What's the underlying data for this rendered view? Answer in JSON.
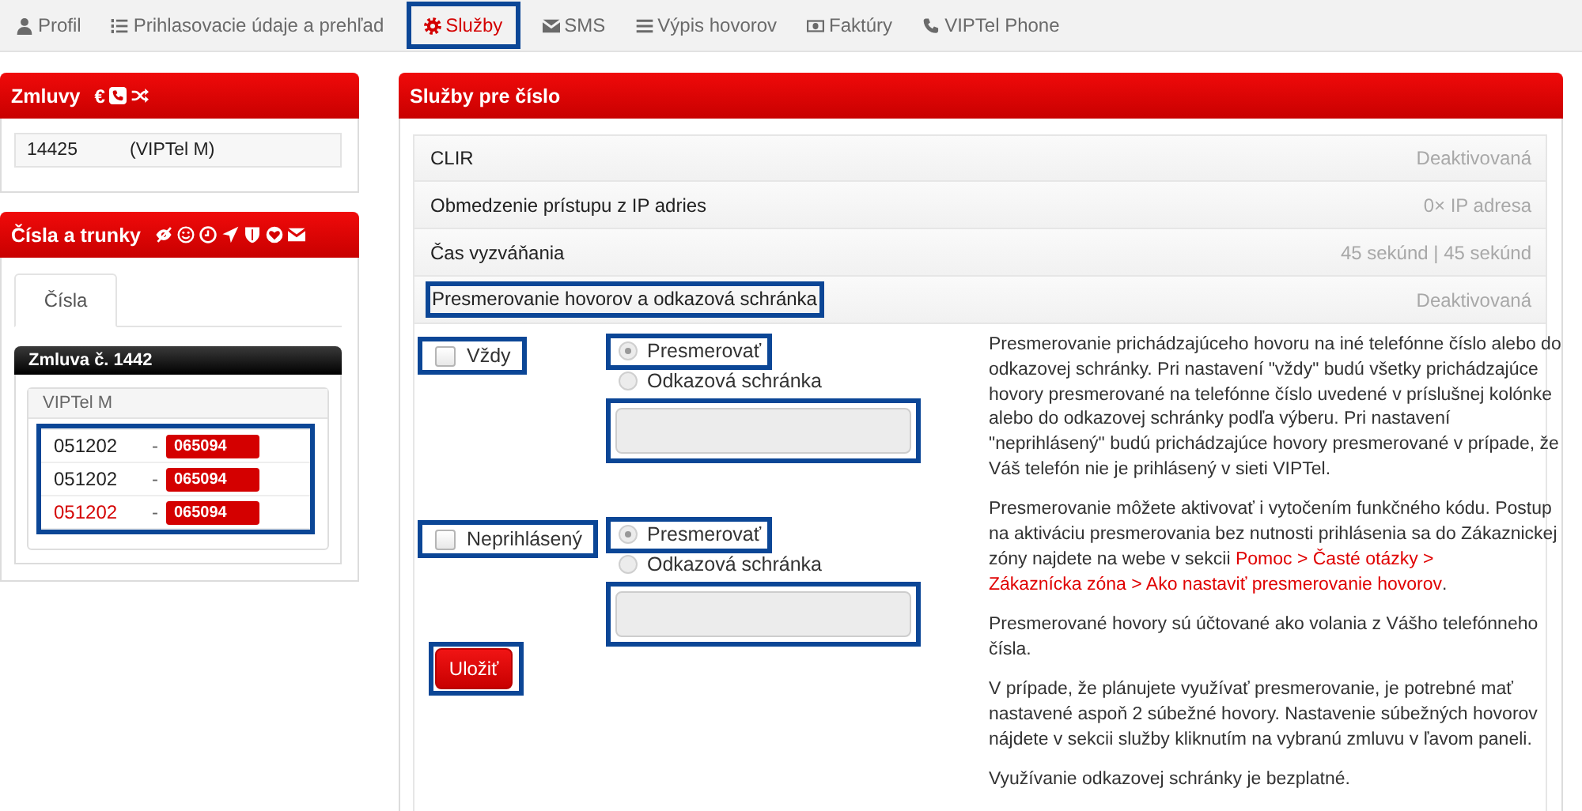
{
  "nav": [
    {
      "label": "Profil",
      "selected": false,
      "highlighted": false
    },
    {
      "label": "Prihlasovacie údaje a prehľad",
      "selected": false,
      "highlighted": false
    },
    {
      "label": "Služby",
      "selected": true,
      "highlighted": true
    },
    {
      "label": "SMS",
      "selected": false,
      "highlighted": false
    },
    {
      "label": "Výpis hovorov",
      "selected": false,
      "highlighted": false
    },
    {
      "label": "Faktúry",
      "selected": false,
      "highlighted": false
    },
    {
      "label": "VIPTel Phone",
      "selected": false,
      "highlighted": false
    }
  ],
  "sidebar": {
    "contracts": {
      "title": "Zmluvy",
      "symbol": "€",
      "rows": [
        {
          "number": "14425",
          "plan": "(VIPTel M)"
        }
      ]
    },
    "numbers": {
      "title": "Čísla a trunky",
      "tabs": [
        {
          "label": "Čísla",
          "selected": true
        }
      ],
      "contract": {
        "title": "Zmluva č. 1442",
        "plan": "VIPTel M",
        "highlighted": true,
        "lines": [
          {
            "number": "051202",
            "separator": "-",
            "badge": "065094",
            "selected": false
          },
          {
            "number": "051202",
            "separator": "-",
            "badge": "065094",
            "selected": false
          },
          {
            "number": "051202",
            "separator": "-",
            "badge": "065094",
            "selected": true
          }
        ]
      }
    }
  },
  "main": {
    "title": "Služby pre číslo",
    "services": [
      {
        "name": "CLIR",
        "status": "Deaktivovaná",
        "highlighted": false
      },
      {
        "name": "Obmedzenie prístupu z IP adries",
        "status": "0× IP adresa",
        "highlighted": false
      },
      {
        "name": "Čas vyzváňania",
        "status": "45 sekúnd | 45 sekúnd",
        "highlighted": false
      },
      {
        "name": "Presmerovanie hovorov a odkazová schránka",
        "status": "Deaktivovaná",
        "highlighted": true
      }
    ],
    "forwarding": {
      "options": [
        {
          "label": "Vždy",
          "checked": false,
          "highlighted": true,
          "targets": [
            {
              "label": "Presmerovať",
              "selected": true,
              "highlighted": true
            },
            {
              "label": "Odkazová schránka",
              "selected": false,
              "highlighted": false
            }
          ],
          "field": {
            "highlighted": true
          }
        },
        {
          "label": "Neprihlásený",
          "checked": false,
          "highlighted": true,
          "targets": [
            {
              "label": "Presmerovať",
              "selected": true,
              "highlighted": true
            },
            {
              "label": "Odkazová schránka",
              "selected": false,
              "highlighted": false
            }
          ],
          "field": {
            "highlighted": true
          }
        }
      ],
      "save_button": {
        "label": "Uložiť",
        "highlighted": true
      },
      "help": [
        {
          "parts": [
            {
              "kind": "text",
              "text": "Presmerovanie prichádzajúceho hovoru na iné telefónne číslo alebo do odkazovej schránky. Pri nastavení \"vždy\" budú všetky prichádzajúce hovory presmerované na telefónne číslo uvedené v príslušnej kolónke alebo do odkazovej schránky podľa výberu. Pri nastavení \"neprihlásený\" budú prichádzajúce hovory presmerované v prípade, že Váš telefón nie je prihlásený v sieti VIPTel."
            }
          ]
        },
        {
          "parts": [
            {
              "kind": "text",
              "text": "Presmerovanie môžete aktivovať i vytočením funkčného kódu. Postup na aktiváciu presmerovania bez nutnosti prihlásenia sa do Zákaznickej zóny najdete na webe v sekcii "
            },
            {
              "kind": "link",
              "text": "Pomoc > Časté otázky >"
            },
            {
              "kind": "link",
              "text": "Zákaznícka zóna > Ako nastaviť presmerovanie hovorov"
            },
            {
              "kind": "text",
              "text": "."
            }
          ]
        },
        {
          "parts": [
            {
              "kind": "text",
              "text": "Presmerované hovory sú účtované ako volania z Vášho telefónneho čísla."
            }
          ]
        },
        {
          "parts": [
            {
              "kind": "text",
              "text": "V prípade, že plánujete využívať presmerovanie, je potrebné mať nastavené aspoň 2 súbežné hovory. Nastavenie súbežných hovorov nájdete v sekcii služby kliknutím na vybranú zmluvu v ľavom paneli."
            }
          ]
        },
        {
          "parts": [
            {
              "kind": "text",
              "text": "Využívanie odkazovej schránky je bezplatné."
            }
          ]
        }
      ]
    }
  }
}
